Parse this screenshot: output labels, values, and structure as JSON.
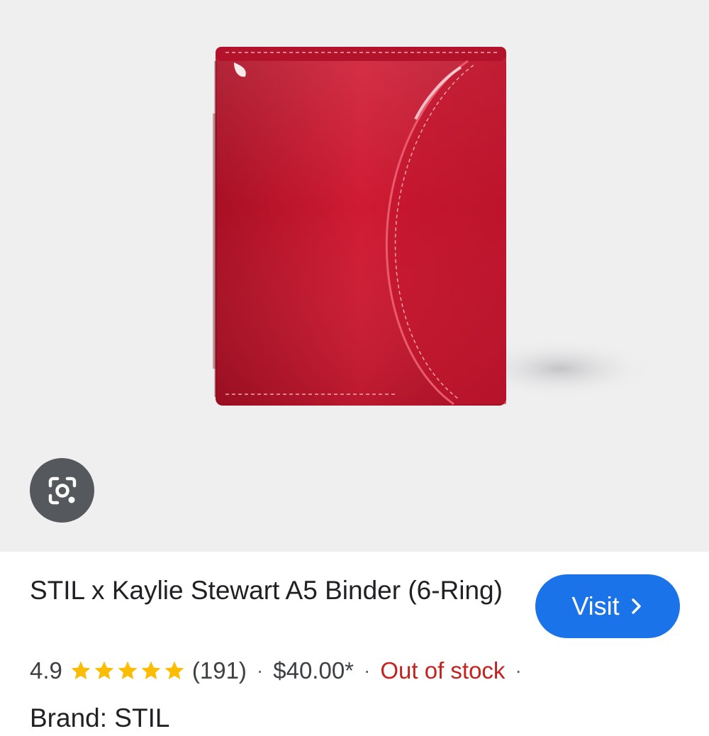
{
  "product": {
    "title": "STIL x Kaylie Stewart A5 Binder (6-Ring)",
    "rating": "4.9",
    "rating_stars": 5,
    "review_count": "(191)",
    "price": "$40.00*",
    "stock_status": "Out of stock",
    "trailing_separator": "·",
    "next_line_partial": "Brand: STIL"
  },
  "actions": {
    "visit_label": "Visit"
  },
  "icons": {
    "lens": "lens-camera-icon",
    "visit": "chevron-right-icon",
    "star": "star-icon"
  },
  "colors": {
    "binder_red": "#c0142c",
    "visit_button": "#1a73e8",
    "out_of_stock": "#c5221f",
    "star": "#fbbc04"
  }
}
